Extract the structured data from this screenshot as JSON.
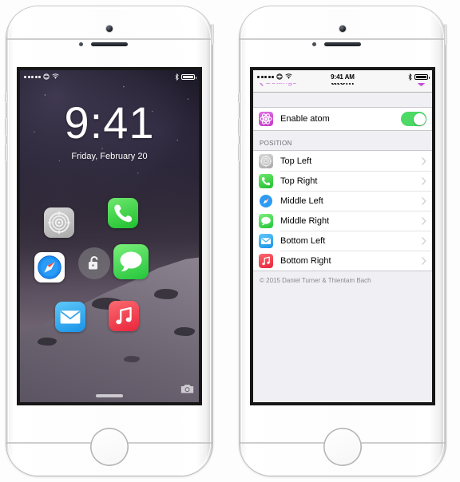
{
  "left_phone": {
    "device_name": "iPhone 5s silver",
    "status_bar": {
      "signal_dots": 5,
      "carrier_icon": "carrier-icon",
      "wifi_icon": "wifi-icon",
      "bluetooth_icon": "bluetooth-icon",
      "battery_icon": "battery-icon"
    },
    "lock_screen": {
      "time": "9:41",
      "date": "Friday, February 20",
      "unlock_icon": "unlock-padlock-icon",
      "camera_shortcut_icon": "camera-icon",
      "home_bar_icon": "home-indicator-bar",
      "app_icons": [
        {
          "name": "settings-app-icon",
          "label": "Settings",
          "position": "top-left"
        },
        {
          "name": "phone-app-icon",
          "label": "Phone",
          "position": "top-right"
        },
        {
          "name": "safari-app-icon",
          "label": "Safari",
          "position": "middle-left"
        },
        {
          "name": "messages-app-icon",
          "label": "Messages",
          "position": "middle-right"
        },
        {
          "name": "mail-app-icon",
          "label": "Mail",
          "position": "bottom-left"
        },
        {
          "name": "music-app-icon",
          "label": "Music",
          "position": "bottom-right"
        }
      ]
    }
  },
  "right_phone": {
    "device_name": "iPhone 5s silver",
    "status_bar": {
      "time": "9:41 AM",
      "signal_dots": 5,
      "carrier_icon": "carrier-icon",
      "wifi_icon": "wifi-icon",
      "bluetooth_icon": "bluetooth-icon",
      "battery_icon": "battery-icon"
    },
    "navbar": {
      "back_label": "Settings",
      "back_icon": "chevron-left-icon",
      "title": "atom",
      "right_icon": "heart-icon",
      "tint_color": "#d07ae0"
    },
    "enable_row": {
      "icon": "atom-app-icon",
      "label": "Enable atom",
      "toggle_state": "on",
      "toggle_on_color": "#4cd964"
    },
    "section": {
      "header": "POSITION",
      "rows": [
        {
          "icon": "settings-app-icon",
          "label": "Top Left",
          "accessory": "chevron-right-icon"
        },
        {
          "icon": "phone-app-icon",
          "label": "Top Right",
          "accessory": "chevron-right-icon"
        },
        {
          "icon": "safari-app-icon",
          "label": "Middle Left",
          "accessory": "chevron-right-icon"
        },
        {
          "icon": "messages-app-icon",
          "label": "Middle Right",
          "accessory": "chevron-right-icon"
        },
        {
          "icon": "mail-app-icon",
          "label": "Bottom Left",
          "accessory": "chevron-right-icon"
        },
        {
          "icon": "music-app-icon",
          "label": "Bottom Right",
          "accessory": "chevron-right-icon"
        }
      ]
    },
    "footer": "© 2015 Daniel Turner & Thientam Bach"
  }
}
